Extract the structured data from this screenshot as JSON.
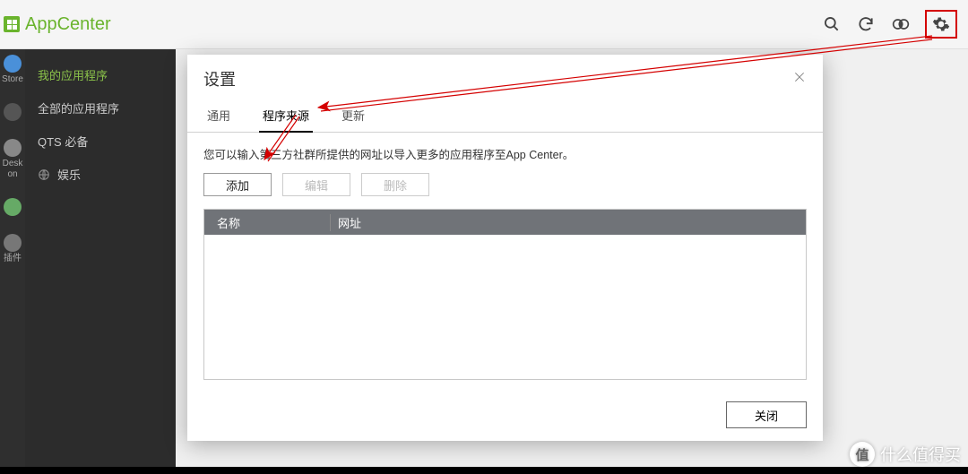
{
  "app_title": "AppCenter",
  "topbar_icons": {
    "search": "search-icon",
    "refresh": "refresh-icon",
    "install": "install-icon",
    "settings": "gear-icon"
  },
  "mini_rail": {
    "items": [
      "Store",
      "",
      "Desk on",
      "",
      "插件"
    ]
  },
  "sidebar": {
    "items": [
      {
        "label": "我的应用程序",
        "active": true
      },
      {
        "label": "全部的应用程序",
        "active": false
      },
      {
        "label": "QTS 必备",
        "active": false
      },
      {
        "label": "娱乐",
        "active": false,
        "icon": "globe-icon"
      }
    ]
  },
  "modal": {
    "title": "设置",
    "tabs": [
      {
        "label": "通用",
        "active": false
      },
      {
        "label": "程序来源",
        "active": true
      },
      {
        "label": "更新",
        "active": false
      }
    ],
    "description": "您可以输入第三方社群所提供的网址以导入更多的应用程序至App Center。",
    "buttons": {
      "add": "添加",
      "edit": "编辑",
      "delete": "删除"
    },
    "table": {
      "col_name": "名称",
      "col_url": "网址",
      "rows": []
    },
    "close_label": "关闭"
  },
  "watermark": {
    "badge": "值",
    "text": "什么值得买"
  },
  "colors": {
    "brand_green": "#6ab42d",
    "highlight_red": "#d40000",
    "table_header": "#707378"
  }
}
